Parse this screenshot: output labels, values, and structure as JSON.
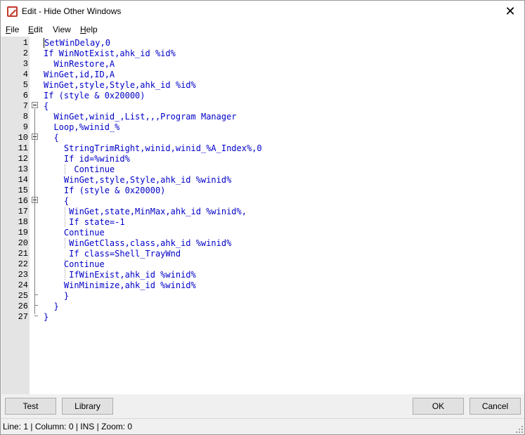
{
  "window": {
    "title": "Edit - Hide Other Windows",
    "close_glyph": "✕"
  },
  "menu": {
    "file": {
      "accel": "F",
      "rest": "ile"
    },
    "edit": {
      "accel": "E",
      "rest": "dit"
    },
    "view": {
      "text": "View"
    },
    "help": {
      "accel": "H",
      "rest": "elp"
    }
  },
  "editor": {
    "line_numbers": [
      "1",
      "2",
      "3",
      "4",
      "5",
      "6",
      "7",
      "8",
      "9",
      "10",
      "11",
      "12",
      "13",
      "14",
      "15",
      "16",
      "17",
      "18",
      "19",
      "20",
      "21",
      "22",
      "23",
      "24",
      "25",
      "26",
      "27"
    ],
    "lines": [
      "SetWinDelay,0",
      "If WinNotExist,ahk_id %id%",
      "  WinRestore,A",
      "WinGet,id,ID,A",
      "WinGet,style,Style,ahk_id %id%",
      "If (style & 0x20000)",
      "{",
      "  WinGet,winid_,List,,,Program Manager",
      "  Loop,%winid_%",
      "  {",
      "    StringTrimRight,winid,winid_%A_Index%,0",
      "    If id=%winid%",
      "      Continue",
      "    WinGet,style,Style,ahk_id %winid%",
      "    If (style & 0x20000)",
      "    {",
      "     WinGet,state,MinMax,ahk_id %winid%,",
      "     If state=-1",
      "    Continue",
      "     WinGetClass,class,ahk_id %winid%",
      "     If class=Shell_TrayWnd",
      "    Continue",
      "     IfWinExist,ahk_id %winid%",
      "    WinMinimize,ahk_id %winid%",
      "    }",
      "  }",
      "}"
    ]
  },
  "buttons": {
    "test": "Test",
    "library": "Library",
    "ok": "OK",
    "cancel": "Cancel"
  },
  "status": {
    "text": "Line: 1  |  Column: 0  |  INS  |  Zoom: 0"
  },
  "colors": {
    "keyword": "#0000c8",
    "string": "#a31515",
    "app_icon": "#c0392b"
  },
  "icons": {
    "app": "edit-app-icon",
    "close": "close-icon",
    "fold": "fold-minus-icon",
    "grip": "resize-grip-icon"
  }
}
